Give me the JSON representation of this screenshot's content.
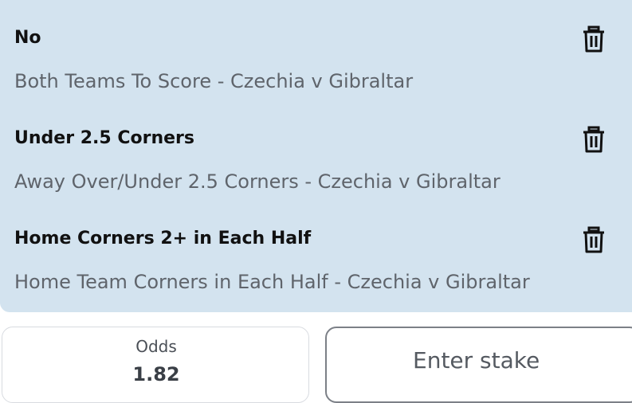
{
  "selections": [
    {
      "title": "No",
      "market": "Both Teams To Score - Czechia v Gibraltar",
      "icon": "trash-icon"
    },
    {
      "title": "Under 2.5 Corners",
      "market": "Away Over/Under 2.5 Corners - Czechia v Gibraltar",
      "icon": "trash-icon"
    },
    {
      "title": "Home Corners 2+ in Each Half",
      "market": "Home Team Corners in Each Half - Czechia v Gibraltar",
      "icon": "trash-icon"
    }
  ],
  "odds": {
    "label": "Odds",
    "value": "1.82"
  },
  "stake": {
    "placeholder": "Enter stake",
    "value": ""
  },
  "colors": {
    "panel_background": "#d3e3ef",
    "title_text": "#111111",
    "subtitle_text": "#5f646b"
  }
}
